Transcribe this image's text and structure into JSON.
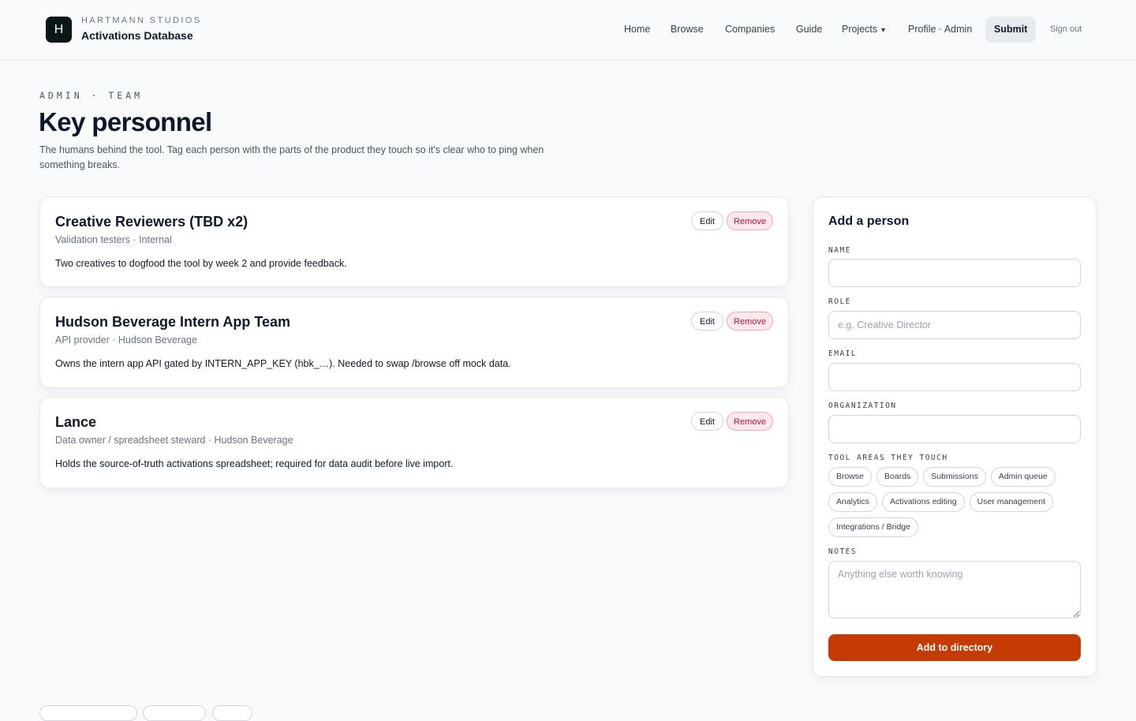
{
  "brand": {
    "logo_letter": "H",
    "overline": "HARTMANN STUDIOS",
    "title": "Activations Database"
  },
  "nav": {
    "home": "Home",
    "browse": "Browse",
    "companies": "Companies",
    "guide": "Guide",
    "projects": "Projects",
    "profile": "Profile · Admin",
    "submit": "Submit",
    "signout": "Sign out"
  },
  "hero": {
    "eyebrow": "ADMIN · TEAM",
    "title": "Key personnel",
    "description": "The humans behind the tool. Tag each person with the parts of the product they touch so it's clear who to ping when something breaks."
  },
  "people": [
    {
      "name": "Creative Reviewers (TBD x2)",
      "meta": "Validation testers · Internal",
      "note": "Two creatives to dogfood the tool by week 2 and provide feedback."
    },
    {
      "name": "Hudson Beverage Intern App Team",
      "meta": "API provider · Hudson Beverage",
      "note": "Owns the intern app API gated by INTERN_APP_KEY (hbk_…). Needed to swap /browse off mock data."
    },
    {
      "name": "Lance",
      "meta": "Data owner / spreadsheet steward · Hudson Beverage",
      "note": "Holds the source-of-truth activations spreadsheet; required for data audit before live import."
    }
  ],
  "card_actions": {
    "edit": "Edit",
    "remove": "Remove"
  },
  "form": {
    "title": "Add a person",
    "name_label": "NAME",
    "name_value": "",
    "role_label": "ROLE",
    "role_placeholder": "e.g. Creative Director",
    "email_label": "EMAIL",
    "email_value": "",
    "org_label": "ORGANIZATION",
    "org_value": "",
    "areas_label": "TOOL AREAS THEY TOUCH",
    "areas": [
      "Browse",
      "Boards",
      "Submissions",
      "Admin queue",
      "Analytics",
      "Activations editing",
      "User management",
      "Integrations / Bridge"
    ],
    "notes_label": "NOTES",
    "notes_placeholder": "Anything else worth knowing",
    "submit": "Add to directory"
  },
  "colors": {
    "accent": "#c43b05",
    "remove_text": "#be123c",
    "remove_bg": "#fde8ec",
    "logo_bg": "#0b1616",
    "page_bg": "#f8fafc"
  }
}
